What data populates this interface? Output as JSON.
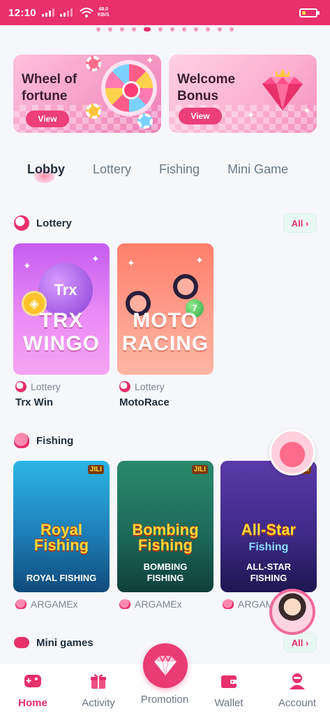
{
  "status_bar": {
    "time": "12:10",
    "net_speed_value": "48.0",
    "net_speed_unit": "KB/S",
    "battery_level": 0.25,
    "accent": "#e8306a"
  },
  "carousel": {
    "dot_count": 12,
    "active_index": 4
  },
  "banners": [
    {
      "title": "Wheel of fortune",
      "button": "View",
      "icon": "wheel-of-fortune-icon"
    },
    {
      "title": "Welcome Bonus",
      "button": "View",
      "icon": "diamond-crown-icon"
    }
  ],
  "tabs": [
    {
      "label": "Lobby",
      "active": true
    },
    {
      "label": "Lottery",
      "active": false
    },
    {
      "label": "Fishing",
      "active": false
    },
    {
      "label": "Mini Game",
      "active": false
    }
  ],
  "sections": {
    "lottery": {
      "title": "Lottery",
      "all_label": "All",
      "icon": "lottery-ball-icon"
    },
    "fishing": {
      "title": "Fishing",
      "icon": "octopus-icon"
    },
    "mini_games": {
      "title": "Mini games",
      "all_label": "All",
      "icon": "gamepad-icon"
    }
  },
  "lottery_games": [
    {
      "art_line1": "TRX",
      "art_line2": "WINGO",
      "ball_text": "Trx",
      "category": "Lottery",
      "name": "Trx Win"
    },
    {
      "art_line1": "MOTO",
      "art_line2": "RACING",
      "ball_text": "7",
      "category": "Lottery",
      "name": "MotoRace"
    }
  ],
  "fishing_games": [
    {
      "logo_line1": "Royal",
      "logo_line2": "Fishing",
      "caption_line1": "ROYAL FISHING",
      "caption_line2": "",
      "provider_badge": "JILI",
      "provider": "ARGAMEx"
    },
    {
      "logo_line1": "Bombing",
      "logo_line2": "Fishing",
      "caption_line1": "BOMBING",
      "caption_line2": "FISHING",
      "provider_badge": "JILI",
      "provider": "ARGAMEx"
    },
    {
      "logo_line1": "All-Star",
      "logo_line2": "Fishing",
      "caption_line1": "ALL-STAR",
      "caption_line2": "FISHING",
      "provider_badge": "JILI",
      "provider": "ARGAM"
    }
  ],
  "bottom_nav": [
    {
      "label": "Home",
      "icon": "gamepad-home-icon",
      "active": true
    },
    {
      "label": "Activity",
      "icon": "gift-icon",
      "active": false
    },
    {
      "label": "Promotion",
      "icon": "diamond-icon",
      "active": false
    },
    {
      "label": "Wallet",
      "icon": "wallet-icon",
      "active": false
    },
    {
      "label": "Account",
      "icon": "account-icon",
      "active": false
    }
  ]
}
